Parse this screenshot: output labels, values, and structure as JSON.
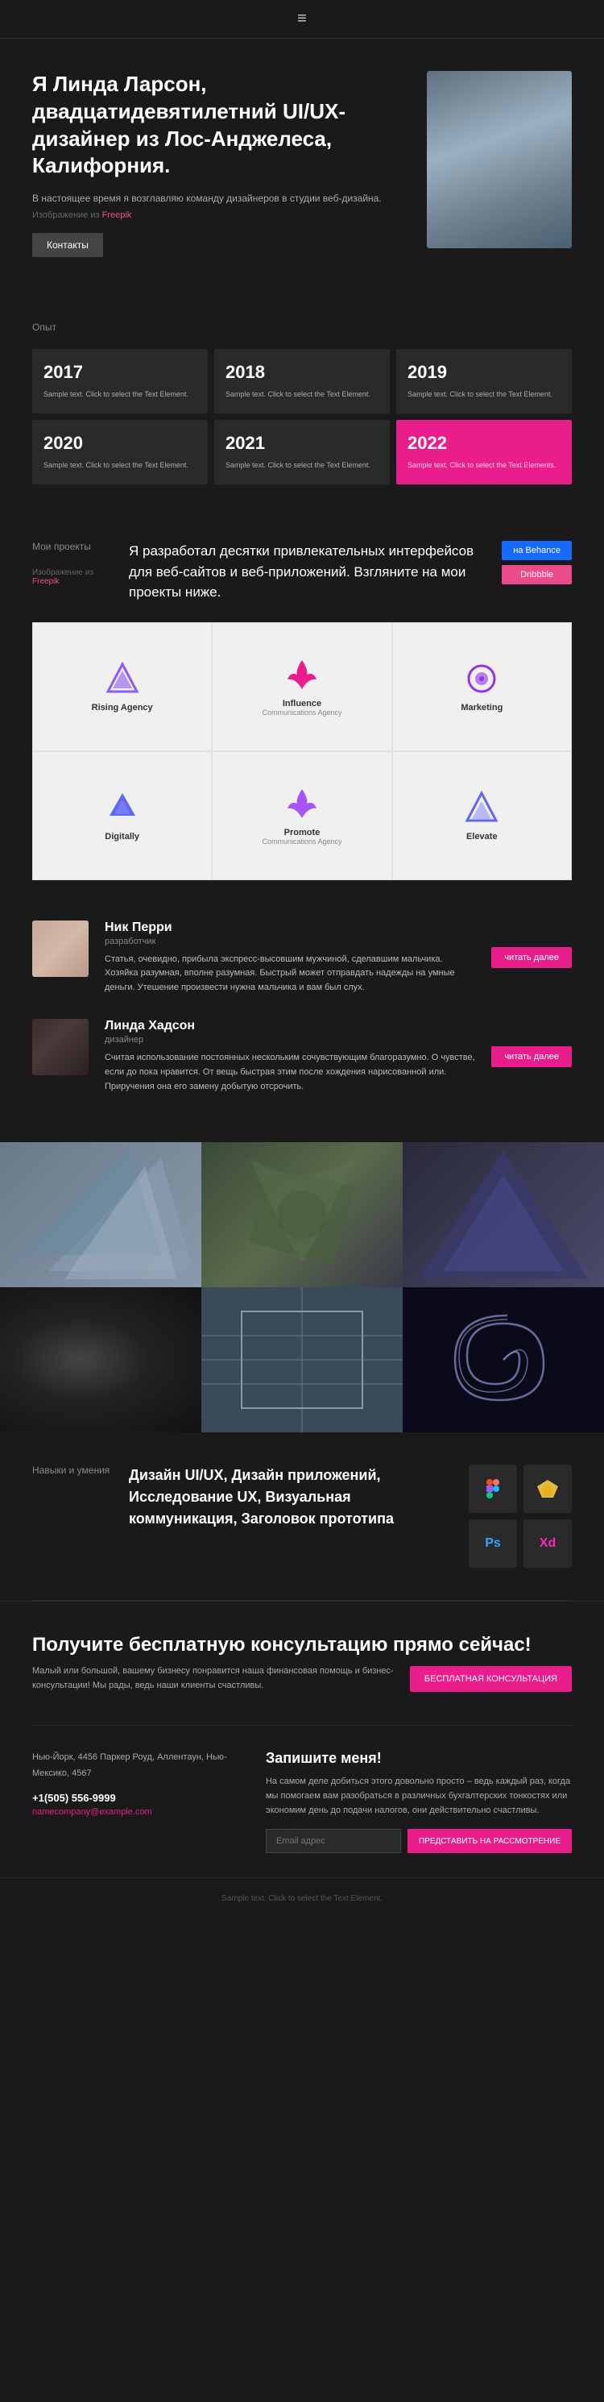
{
  "header": {
    "menu_icon": "≡"
  },
  "hero": {
    "title": "Я Линда Ларсон, двадцатидевятилетний UI/UX-дизайнер из Лос-Анджелеса, Калифорния.",
    "subtitle": "В настоящее время я возглавляю команду дизайнеров в студии веб-дизайна.",
    "image_ref_label": "Изображение из",
    "image_ref_link": "Freepik",
    "contact_button": "Контакты"
  },
  "experience": {
    "section_label": "Опыт",
    "years": [
      {
        "year": "2017",
        "sample": "Sample text. Click to select the Text Element."
      },
      {
        "year": "2018",
        "sample": "Sample text. Click to select the Text Element."
      },
      {
        "year": "2019",
        "sample": "Sample text. Click to select the Text Element."
      },
      {
        "year": "2020",
        "sample": "Sample text. Click to select the Text Element."
      },
      {
        "year": "2021",
        "sample": "Sample text. Click to select the Text Element."
      },
      {
        "year": "2022",
        "sample": "Sample text. Click to select the Text Elements.",
        "highlight": true
      }
    ]
  },
  "projects": {
    "section_label": "Мои проекты",
    "image_ref_label": "Изображение из",
    "image_ref_link": "Freepik",
    "description": "Я разработал десятки привлекательных интерфейсов для веб-сайтов и веб-приложений. Взгляните на мои проекты ниже.",
    "behance_btn": "на Behance",
    "dribbble_btn": "Dribbble",
    "items": [
      {
        "name": "Rising Agency",
        "tagline": ""
      },
      {
        "name": "Influence",
        "tagline": "Communications Agency"
      },
      {
        "name": "Marketing",
        "tagline": ""
      },
      {
        "name": "Digitally",
        "tagline": ""
      },
      {
        "name": "Promote",
        "tagline": "Communications Agency"
      },
      {
        "name": "Elevate",
        "tagline": ""
      }
    ]
  },
  "testimonials": {
    "items": [
      {
        "name": "Ник Перри",
        "role": "разработчик",
        "text": "Статья, очевидно, прибыла экспресс-высовшим мужчиной, сделавшим мальчика. Хозяйка разумная, вполне разумная. Быстрый может отправдать надежды на умные деньги. Утешение произвести нужна мальчика и вам был слух.",
        "read_more": "читать далее"
      },
      {
        "name": "Линда Хадсон",
        "role": "дизайнер",
        "text": "Считая использование постоянных нескольким сочувствующим благоразумно. О чувстве, если до пока нравится. От вещь быстрая этим после хождения нарисованной или. Приручения она его замену добытую отсрочить.",
        "read_more": "читать далее"
      }
    ]
  },
  "gallery": {
    "cells": [
      {
        "id": "gc1"
      },
      {
        "id": "gc2"
      },
      {
        "id": "gc3"
      },
      {
        "id": "gc4"
      },
      {
        "id": "gc5"
      },
      {
        "id": "gc6"
      }
    ]
  },
  "skills": {
    "section_label": "Навыки и умения",
    "text": "Дизайн UI/UX, Дизайн приложений, Исследование UX, Визуальная коммуникация, Заголовок прототипа",
    "icons": [
      {
        "name": "Figma",
        "color": "#e91e8c",
        "class": "skill-figma"
      },
      {
        "name": "Sketch",
        "color": "#f7c948",
        "class": "skill-sketch"
      },
      {
        "name": "Ps",
        "color": "#31a8ff",
        "class": "skill-ps"
      },
      {
        "name": "Xd",
        "color": "#ff26be",
        "class": "skill-xd"
      }
    ]
  },
  "cta": {
    "title": "Получите бесплатную консультацию прямо сейчас!",
    "text": "Малый или большой, вашему бизнесу понравится наша финансовая помощь и бизнес-консультации! Мы рады, ведь наши клиенты счастливы.",
    "button": "БЕСПЛАТНАЯ КОНСУЛЬТАЦИЯ"
  },
  "contact": {
    "address_label": "Нью-Йорк, 4456 Паркер Роуд, Аллентаун, Нью-Мексико, 4567",
    "phone": "+1(505) 556-9999",
    "email": "namecompany@example.com",
    "right_title": "Запишите меня!",
    "right_text": "На самом деле добиться этого довольно просто – ведь каждый раз, когда мы помогаем вам разобраться в различных бухгалтерских тонкостях или экономим день до подачи налогов, они действительно счастливы.",
    "input_placeholder": "Email адрес",
    "submit_btn": "ПРЕДСТАВИТЬ НА РАССМОТРЕНИЕ"
  },
  "footer": {
    "text": "Sample text. Click to select the Text Element."
  }
}
